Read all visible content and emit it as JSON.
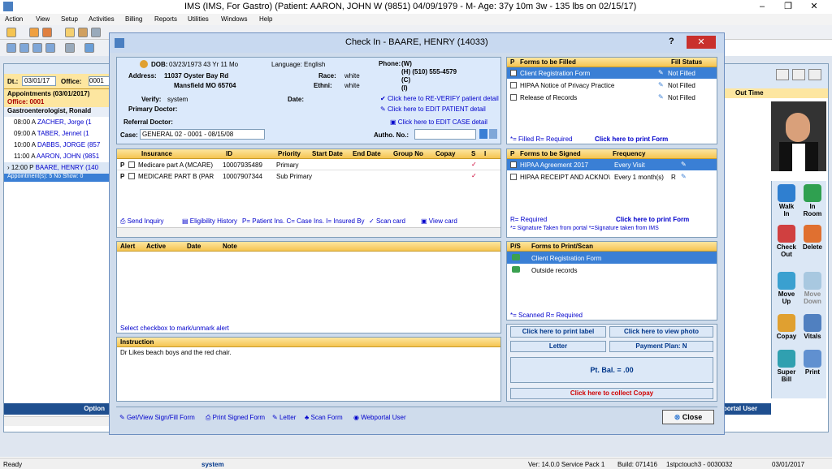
{
  "window": {
    "title": "IMS (IMS, For Gastro)     (Patient: AARON, JOHN W (9851) 04/09/1979 - M- Age: 37y 10m 3w - 135 lbs on 02/15/17)",
    "minimize": "–",
    "maximize": "❐",
    "close": "✕"
  },
  "menu": [
    "Action",
    "View",
    "Setup",
    "Activities",
    "Billing",
    "Reports",
    "Utilities",
    "Windows",
    "Help"
  ],
  "left": {
    "dt_label": "Dt.:",
    "dt_value": "03/01/17",
    "office_label": "Office:",
    "office_value": "0001",
    "appts_header": "Appointments (03/01/2017)",
    "office_row": "Office: 0001",
    "provider": "Gastroenterologist, Ronald",
    "appointments": [
      {
        "time": "08:00 A",
        "name": "ZACHER, Jorge (1"
      },
      {
        "time": "09:00 A",
        "name": "TABER, Jennet (1"
      },
      {
        "time": "10:00 A",
        "name": "DABBS, JORGE (857"
      },
      {
        "time": "11:00 A",
        "name": "AARON, JOHN (9851"
      },
      {
        "time": "12:00 P",
        "name": "BAARE, HENRY (140"
      }
    ],
    "summary": "Appointment(s): 5  No Show: 0",
    "option": "Option"
  },
  "right": {
    "out_time": "Out Time",
    "buttons": [
      {
        "l1": "Walk",
        "l2": "In"
      },
      {
        "l1": "In",
        "l2": "Room"
      },
      {
        "l1": "Check",
        "l2": "Out"
      },
      {
        "l1": "Delete",
        "l2": ""
      },
      {
        "l1": "Move",
        "l2": "Up"
      },
      {
        "l1": "Move",
        "l2": "Down"
      },
      {
        "l1": "Copay",
        "l2": ""
      },
      {
        "l1": "Vitals",
        "l2": ""
      },
      {
        "l1": "Super",
        "l2": "Bill"
      },
      {
        "l1": "Print",
        "l2": ""
      }
    ],
    "portal_user": "oportal User"
  },
  "dialog": {
    "title": "Check In - BAARE, HENRY  (14033)",
    "help": "?",
    "close": "✕",
    "patient": {
      "dob_label": "DOB:",
      "dob": "03/23/1973  43 Yr 11 Mo",
      "language": "Language: English",
      "address_label": "Address:",
      "address1": "11037 Oyster Bay Rd",
      "address2": "Mansfield  MO  65704",
      "race_label": "Race:",
      "race": "white",
      "ethni_label": "Ethni:",
      "ethni": "white",
      "phone_label": "Phone:",
      "phone_w": "(W)",
      "phone_h": "(H)   (510)  555-4579",
      "phone_c": "(C)",
      "phone_i": "(I)",
      "verify_label": "Verify:",
      "verify": "system",
      "date_label": "Date:",
      "reverify": "Click here to RE-VERIFY patient detail",
      "edit_patient": "Click here to EDIT PATIENT detail",
      "primary_doctor": "Primary Doctor:",
      "referral_doctor": "Referral Doctor:",
      "edit_case": "Click here to EDIT CASE detail",
      "case_label": "Case:",
      "case_value": "GENERAL 02  -  0001 - 08/15/08",
      "autho_label": "Autho. No.:"
    },
    "insurance": {
      "headers": [
        "Insurance",
        "ID",
        "Priority",
        "Start Date",
        "End Date",
        "Group No",
        "Copay",
        "S",
        "I"
      ],
      "rows": [
        {
          "p": "P",
          "name": "Medicare part A  (MCARE)",
          "id": "10007935489",
          "priority": "Primary"
        },
        {
          "p": "P",
          "name": "MEDICARE PART B  (PAR",
          "id": "10007907344",
          "priority": "Sub Primary"
        }
      ],
      "send_inquiry": "Send Inquiry",
      "eligibility": "Eligibility History",
      "legend": "P= Patient Ins. C= Case Ins.  I= Insured By",
      "scan_card": "Scan card",
      "view_card": "View card"
    },
    "alerts": {
      "headers": [
        "Alert",
        "Active",
        "Date",
        "Note"
      ],
      "footer": "Select checkbox to mark/unmark alert"
    },
    "instruction": {
      "header": "Instruction",
      "text": "Dr Likes beach boys and the red chair."
    },
    "forms_filled": {
      "h_p": "P",
      "header": "Forms to be Filled",
      "status": "Fill Status",
      "rows": [
        {
          "name": "Client Registration Form",
          "status": "Not Filled"
        },
        {
          "name": "HIPAA Notice of Privacy Practice",
          "status": "Not Filled"
        },
        {
          "name": "Release of Records",
          "status": "Not Filled"
        }
      ],
      "legend": "*= Filled  R= Required",
      "print": "Click here to print Form"
    },
    "forms_signed": {
      "h_p": "P",
      "header": "Forms to be Signed",
      "frequency": "Frequency",
      "rows": [
        {
          "name": "HIPAA Agreement 2017",
          "freq": "Every Visit",
          "r": ""
        },
        {
          "name": "HIPAA RECEIPT AND ACKNO\\",
          "freq": "Every 1 month(s)",
          "r": "R"
        }
      ],
      "legend1": "R= Required",
      "print": "Click here to print Form",
      "legend2": "*= Signature Taken from portal  *=Signature taken from IMS"
    },
    "forms_print": {
      "h_ps": "P/S",
      "header": "Forms to Print/Scan",
      "rows": [
        "Client Registration Form",
        "Outside records"
      ],
      "legend": "*= Scanned   R= Required"
    },
    "actions": {
      "print_label": "Click here to print label",
      "view_photo": "Click here to view photo",
      "letter": "Letter",
      "payment_plan": "Payment Plan: N",
      "balance": "Pt. Bal. = .00",
      "collect": "Click here to collect Copay"
    },
    "bottom": [
      "Get/View Sign/Fill Form",
      "Print Signed Form",
      "Letter",
      "Scan Form",
      "Webportal User"
    ],
    "close_btn": "Close"
  },
  "status": {
    "ready": "Ready",
    "user": "system",
    "version": "Ver: 14.0.0 Service Pack 1",
    "build": "Build: 071416",
    "station": "1stpctouch3 - 0030032",
    "date": "03/01/2017"
  },
  "colors": {
    "header": "#f5c451",
    "selected": "#3a7fd5",
    "link": "#0000cc",
    "red": "#d00000"
  }
}
